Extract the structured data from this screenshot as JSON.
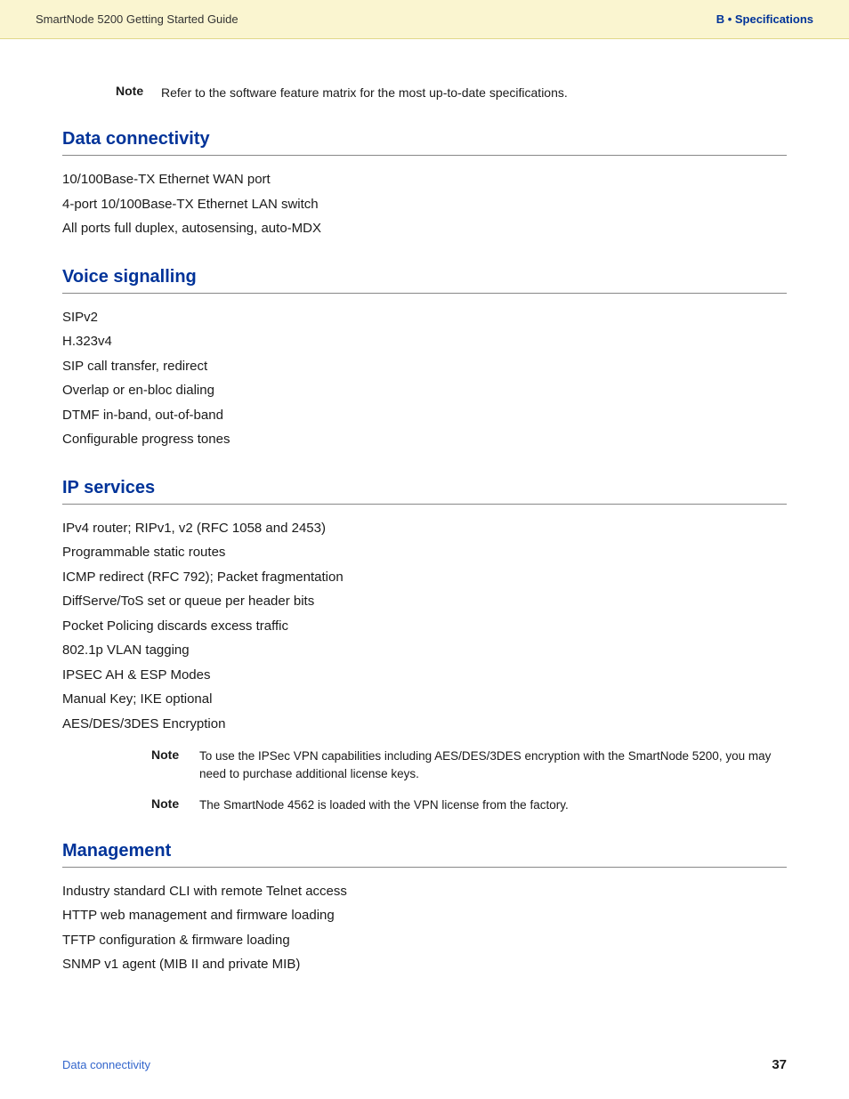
{
  "header": {
    "left_text": "SmartNode 5200 Getting Started Guide",
    "right_text": "B • Specifications"
  },
  "intro_note": {
    "label": "Note",
    "text": "Refer to the software feature matrix for the most up-to-date specifications."
  },
  "sections": [
    {
      "id": "data-connectivity",
      "heading": "Data connectivity",
      "items": [
        "10/100Base-TX Ethernet WAN port",
        "4-port 10/100Base-TX Ethernet LAN switch",
        "All ports full duplex, autosensing, auto-MDX"
      ],
      "notes": []
    },
    {
      "id": "voice-signalling",
      "heading": "Voice signalling",
      "items": [
        "SIPv2",
        "H.323v4",
        "SIP call transfer, redirect",
        "Overlap or en-bloc dialing",
        "DTMF in-band, out-of-band",
        "Configurable progress tones"
      ],
      "notes": []
    },
    {
      "id": "ip-services",
      "heading": "IP services",
      "items": [
        "IPv4 router; RIPv1, v2 (RFC 1058 and 2453)",
        "Programmable static routes",
        "ICMP redirect (RFC 792); Packet fragmentation",
        "DiffServe/ToS set or queue per header bits",
        "Pocket Policing discards excess traffic",
        "802.1p VLAN tagging",
        "IPSEC AH & ESP Modes",
        "Manual Key; IKE optional",
        "AES/DES/3DES Encryption"
      ],
      "notes": [
        {
          "label": "Note",
          "text": "To use the IPSec VPN capabilities including AES/DES/3DES encryption with the SmartNode 5200, you may need to purchase additional license keys."
        },
        {
          "label": "Note",
          "text": "The SmartNode 4562 is loaded with the VPN license from the factory."
        }
      ]
    },
    {
      "id": "management",
      "heading": "Management",
      "items": [
        "Industry standard CLI with remote Telnet access",
        "HTTP web management and firmware loading",
        "TFTP configuration & firmware loading",
        "SNMP v1 agent (MIB II and private MIB)"
      ],
      "notes": []
    }
  ],
  "footer": {
    "left_text": "Data connectivity",
    "page_number": "37"
  }
}
